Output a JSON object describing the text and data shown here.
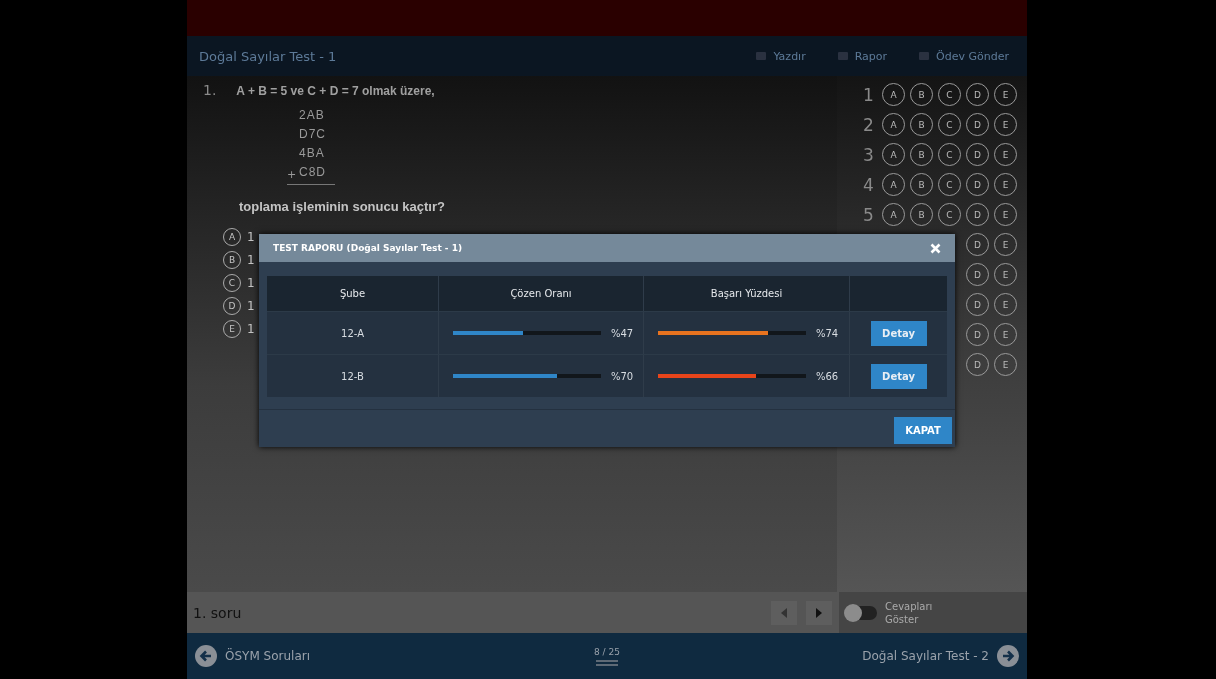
{
  "header": {
    "title": "Doğal Sayılar Test - 1",
    "actions": [
      "Yazdır",
      "Rapor",
      "Ödev Gönder"
    ]
  },
  "question": {
    "number": "1.",
    "stem": "A + B = 5  ve  C + D = 7  olmak üzere,",
    "addends": [
      "2AB",
      "D7C",
      "4BA",
      "C8D"
    ],
    "plus": "+",
    "prompt": "toplama işleminin sonucu kaçtır?",
    "options": [
      {
        "letter": "A",
        "text": "1"
      },
      {
        "letter": "B",
        "text": "1"
      },
      {
        "letter": "C",
        "text": "1"
      },
      {
        "letter": "D",
        "text": "1"
      },
      {
        "letter": "E",
        "text": "1"
      }
    ]
  },
  "answer_sheet": [
    {
      "number": "1",
      "choices": [
        "A",
        "B",
        "C",
        "D",
        "E"
      ]
    },
    {
      "number": "2",
      "choices": [
        "A",
        "B",
        "C",
        "D",
        "E"
      ]
    },
    {
      "number": "3",
      "choices": [
        "A",
        "B",
        "C",
        "D",
        "E"
      ]
    },
    {
      "number": "4",
      "choices": [
        "A",
        "B",
        "C",
        "D",
        "E"
      ]
    },
    {
      "number": "5",
      "choices": [
        "A",
        "B",
        "C",
        "D",
        "E"
      ]
    },
    {
      "choices": [
        "D",
        "E"
      ]
    },
    {
      "choices": [
        "D",
        "E"
      ]
    },
    {
      "choices": [
        "D",
        "E"
      ]
    },
    {
      "choices": [
        "D",
        "E"
      ]
    },
    {
      "choices": [
        "D",
        "E"
      ]
    }
  ],
  "footer": {
    "question_label": "1. soru",
    "toggle": {
      "label": "Cevapları Göster",
      "on": false
    }
  },
  "nav": {
    "previous": "ÖSYM Soruları",
    "page": "8 / 25",
    "next": "Doğal Sayılar Test - 2"
  },
  "modal": {
    "title": "TEST RAPORU (Doğal Sayılar Test - 1)",
    "columns": [
      "Şube",
      "Çözen Oranı",
      "Başarı Yüzdesi"
    ],
    "rows": [
      {
        "branch": "12-A",
        "solved": {
          "level": 0.47,
          "reading": "%47",
          "color": "#2f86c8"
        },
        "success": {
          "level": 0.74,
          "reading": "%74",
          "color": "#e8731f"
        },
        "button": "Detay"
      },
      {
        "branch": "12-B",
        "solved": {
          "level": 0.7,
          "reading": "%70",
          "color": "#2f86c8"
        },
        "success": {
          "level": 0.66,
          "reading": "%66",
          "color": "#e8441a"
        },
        "button": "Detay"
      }
    ],
    "close_button": "KAPAT"
  }
}
